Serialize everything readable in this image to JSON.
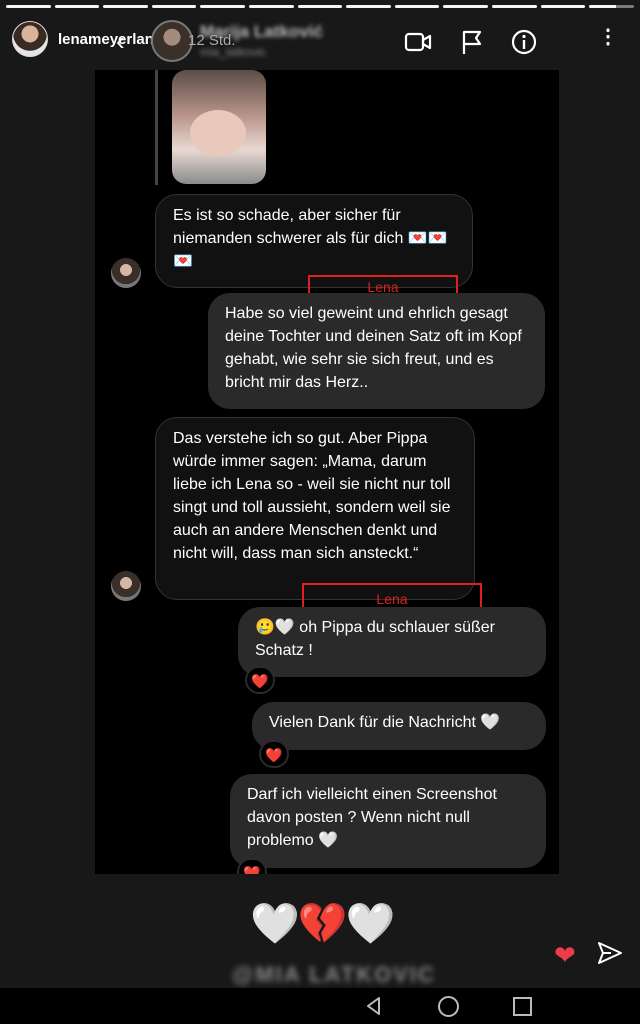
{
  "story": {
    "user": "lenameyerlandrut",
    "time": "12 Std.",
    "segments": 13
  },
  "chat_header": {
    "name": "Marija Latković",
    "handle": "mia_latkovic"
  },
  "messages": [
    {
      "id": "m1",
      "text": "Es ist so schade, aber sicher für niemanden schwerer als für dich 💌💌💌"
    },
    {
      "id": "m2",
      "label": "Lena",
      "text": "Habe so viel geweint und ehrlich gesagt deine Tochter und deinen Satz oft im Kopf gehabt, wie sehr sie sich freut, und es bricht mir das Herz.."
    },
    {
      "id": "m3",
      "text": "Das verstehe ich so gut. Aber Pippa würde immer sagen: „Mama, darum liebe ich Lena so - weil sie nicht nur toll singt und toll aussieht, sondern weil sie auch an andere Menschen denkt und nicht will, dass man sich ansteckt.“"
    },
    {
      "id": "m4",
      "label": "Lena",
      "text": "🥲🤍 oh Pippa du schlauer süßer Schatz !",
      "reaction": "❤️"
    },
    {
      "id": "m5",
      "text": "Vielen Dank für die Nachricht 🤍",
      "reaction": "❤️"
    },
    {
      "id": "m6",
      "text": "Darf ich vielleicht einen Screenshot davon posten ? Wenn nicht null problemo 🤍",
      "reaction": "❤️"
    }
  ],
  "footer": {
    "emojis": "🤍💔🤍",
    "caption": "@MIA LATKOVIC"
  },
  "colors": {
    "label_red": "#e02020",
    "like": "#ed3c4c"
  }
}
